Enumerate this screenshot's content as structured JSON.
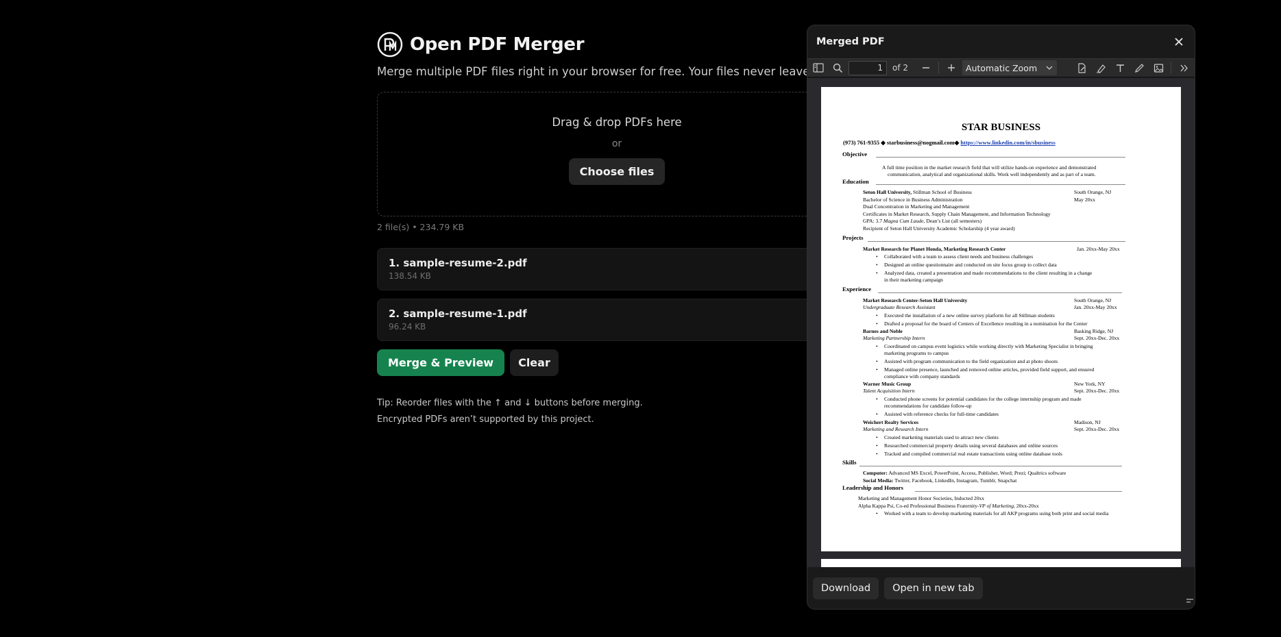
{
  "app": {
    "title": "Open PDF Merger",
    "subtitle": "Merge multiple PDF files right in your browser for free. Your files never leave yo",
    "dropzone": {
      "title": "Drag & drop PDFs here",
      "or": "or",
      "choose_label": "Choose files"
    },
    "file_summary": "2 file(s) • 234.79 KB",
    "files": [
      {
        "name": "1. sample-resume-2.pdf",
        "size": "138.54 KB"
      },
      {
        "name": "2. sample-resume-1.pdf",
        "size": "96.24 KB"
      }
    ],
    "merge_label": "Merge & Preview",
    "clear_label": "Clear",
    "tips": [
      "Tip: Reorder files with the ↑ and ↓ buttons before merging.",
      "Encrypted PDFs aren’t supported by this project."
    ],
    "accent_color": "#16834f"
  },
  "modal": {
    "title": "Merged PDF",
    "toolbar": {
      "page_value": "1",
      "page_of": "of 2",
      "zoom": "Automatic Zoom"
    },
    "download_label": "Download",
    "open_tab_label": "Open in new tab"
  },
  "resume": {
    "name": "STAR BUSINESS",
    "contact_main": "(973) 761-9355 ◆ starbusiness@nogmail.com◆ ",
    "contact_link": "https://www.linkedin.com/in/sbusiness",
    "objective_head": "Objective",
    "objective_1": "A full time position in the market research field that will utilize hands-on experience and demonstrated",
    "objective_2": "communication, analytical and organizational skills. Work well independently and as part of a team.",
    "education_head": "Education",
    "edu_school_b": "Seton Hall University,",
    "edu_school_rest": " Stillman School of Business",
    "edu_loc": "South Orange, NJ",
    "edu_degree": "Bachelor of Science in Business Administration",
    "edu_date": "May 20xx",
    "edu_conc": "Dual Concentration in Marketing and Management",
    "edu_cert": "Certificates in Market Research, Supply Chain Management, and Information Technology",
    "edu_gpa_a": "GPA: 3.7 ",
    "edu_gpa_i": "Magna Cum Laude",
    "edu_gpa_b": ", Dean’s List (all semesters)",
    "edu_schol": "Recipient of Seton Hall University Academic Scholarship (4 year award)",
    "projects_head": "Projects",
    "proj_title": "Market Research for Planet Honda, Marketing Research Center",
    "proj_date": "Jan. 20xx-May 20xx",
    "proj_b1": "Collaborated with a team to assess client needs and business challenges",
    "proj_b2": "Designed an online questionnaire and conducted on site focus group to collect data",
    "proj_b3a": "Analyzed data, created a presentation and made recommendations to the client resulting in a change",
    "proj_b3b": "in their marketing campaign",
    "experience_head": "Experience",
    "exp1_org": "Market Research Center-Seton Hall University",
    "exp1_loc": "South Orange, NJ",
    "exp1_role": "Undergraduate Research Assistant",
    "exp1_date": "Jan. 20xx-May 20xx",
    "exp1_b1": "Executed the installation of a new online survey platform for all Stillman students",
    "exp1_b2": "Drafted a proposal for the board of Centers of Excellence resulting in a nomination for the Center",
    "exp2_org": "Barnes and Noble",
    "exp2_loc": "Basking Ridge, NJ",
    "exp2_role": "Marketing Partnership Intern",
    "exp2_date": "Sept. 20xx-Dec. 20xx",
    "exp2_b1a": "Coordinated on campus event logistics while working directly with Marketing Specialist in bringing",
    "exp2_b1b": "marketing programs to campus",
    "exp2_b2": "Assisted with program communication to the field organization and at photo shoots",
    "exp2_b3a": "Managed online presence, launched and removed online articles, provided field support, and ensured",
    "exp2_b3b": "compliance with company standards",
    "exp3_org": "Warner Music Group",
    "exp3_loc": "New York, NY",
    "exp3_role": "Talent Acquisition Intern",
    "exp3_date": "Sept. 20xx-Dec. 20xx",
    "exp3_b1a": "Conducted phone screens for potential candidates for the college internship program and made",
    "exp3_b1b": "recommendations for candidate follow-up",
    "exp3_b2": "Assisted with reference checks for full-time candidates",
    "exp4_org": "Weichert Realty Services",
    "exp4_loc": "Madison, NJ",
    "exp4_role": "Marketing and Research Intern",
    "exp4_date": "Sept. 20xx-Dec. 20xx",
    "exp4_b1": "Created marketing materials used to attract new clients",
    "exp4_b2": "Researched commercial property details using several databases and online sources",
    "exp4_b3": "Tracked and compiled commercial real estate transactions using online database tools",
    "skills_head": "Skills",
    "skills_comp_label": "Computer:",
    "skills_comp": " Advanced MS Excel, PowerPoint, Access, Publisher, Word; Prezi; Qualtrics software",
    "skills_social_label": "Social Media:",
    "skills_social": " Twitter, Facebook, LinkedIn, Instagram, Tumblr, Snapchat",
    "leadership_head": "Leadership and Honors",
    "lead_1": "Marketing and Management Honor Societies, Inducted 20xx",
    "lead_2a": "Alpha Kappa Psi, Co-ed Professional Business Fraternity-",
    "lead_2i": "VP of Marketing",
    "lead_2b": ", 20xx-20xx",
    "lead_b1": "Worked with a team to develop marketing materials for all AKP programs using both print and social media"
  }
}
